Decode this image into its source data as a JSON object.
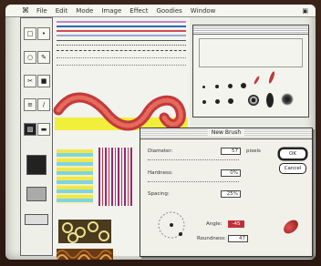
{
  "menubar": {
    "apple": "⌘",
    "items": [
      "File",
      "Edit",
      "Mode",
      "Image",
      "Effect",
      "Goodies",
      "Window"
    ],
    "right_icon": "▣"
  },
  "toolbox": {
    "tool_icons": [
      "□",
      "•",
      "○",
      "✎",
      "✂",
      "■",
      "≡",
      "∕",
      "▨",
      "▬"
    ]
  },
  "dialog": {
    "title": "New Brush",
    "diameter_label": "Diameter:",
    "diameter_value": "57",
    "units": "pixels",
    "hardness_label": "Hardness:",
    "hardness_value": "0%",
    "spacing_label": "Spacing:",
    "spacing_value": "25%",
    "angle_label": "Angle:",
    "angle_value": "-45",
    "roundness_label": "Roundness:",
    "roundness_value": "47",
    "ok_label": "OK",
    "cancel_label": "Cancel"
  },
  "colors": {
    "stroke_outer": "#c23a3a",
    "stroke_inner": "#f0e890",
    "accent_red": "#c0303a",
    "yellow": "#f2ee3c"
  }
}
